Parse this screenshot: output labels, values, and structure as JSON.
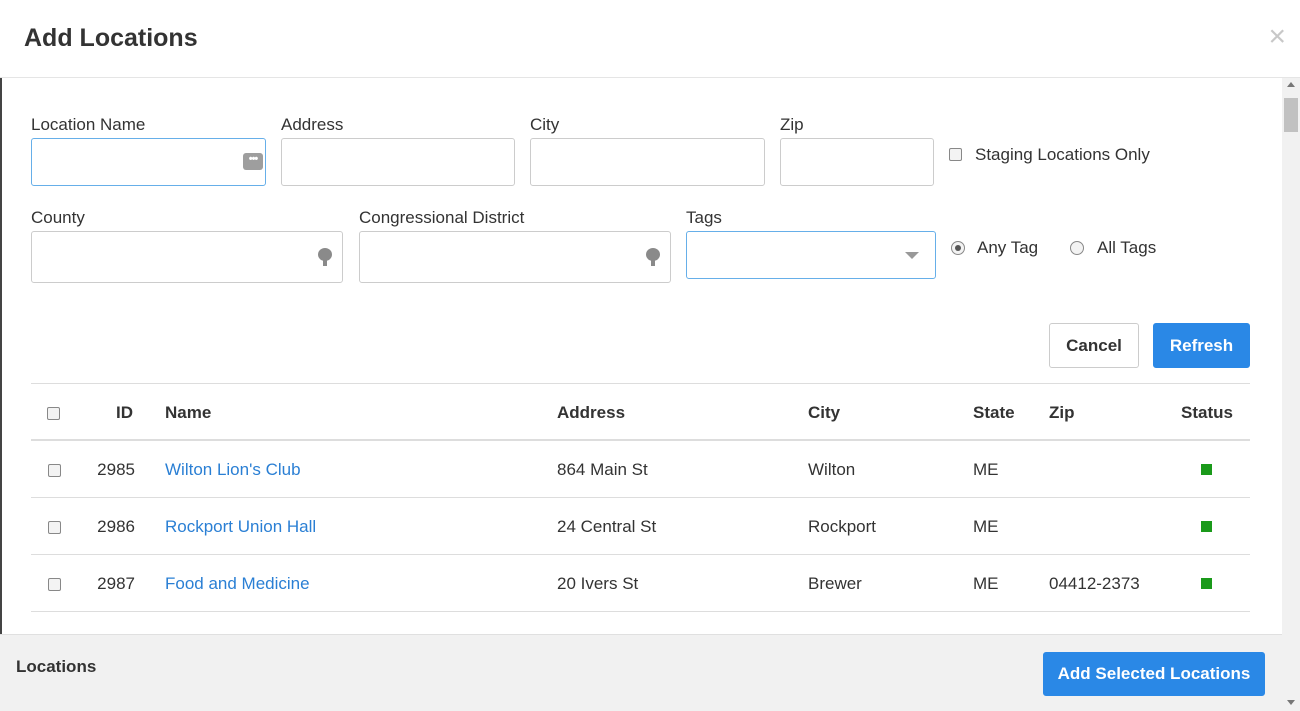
{
  "modal": {
    "title": "Add Locations",
    "close_glyph": "×"
  },
  "filters": {
    "location_name": {
      "label": "Location Name",
      "value": ""
    },
    "address": {
      "label": "Address",
      "value": ""
    },
    "city": {
      "label": "City",
      "value": ""
    },
    "zip": {
      "label": "Zip",
      "value": ""
    },
    "staging_only": {
      "label": "Staging Locations Only",
      "checked": false
    },
    "county": {
      "label": "County",
      "value": ""
    },
    "congressional_district": {
      "label": "Congressional District",
      "value": ""
    },
    "tags": {
      "label": "Tags",
      "value": ""
    },
    "tag_mode": {
      "any_label": "Any Tag",
      "all_label": "All Tags",
      "selected": "any"
    }
  },
  "buttons": {
    "cancel": "Cancel",
    "refresh": "Refresh",
    "add_selected": "Add Selected Locations"
  },
  "table": {
    "columns": {
      "id": "ID",
      "name": "Name",
      "address": "Address",
      "city": "City",
      "state": "State",
      "zip": "Zip",
      "status": "Status"
    },
    "rows": [
      {
        "id": "2985",
        "name": "Wilton Lion's Club",
        "address": "864 Main St",
        "city": "Wilton",
        "state": "ME",
        "zip": "",
        "status": "active"
      },
      {
        "id": "2986",
        "name": "Rockport Union Hall",
        "address": "24 Central St",
        "city": "Rockport",
        "state": "ME",
        "zip": "",
        "status": "active"
      },
      {
        "id": "2987",
        "name": "Food and Medicine",
        "address": "20 Ivers St",
        "city": "Brewer",
        "state": "ME",
        "zip": "04412-2373",
        "status": "active"
      }
    ]
  },
  "footer": {
    "label": "Locations"
  },
  "colors": {
    "primary": "#2a88e6",
    "link": "#2a7fd4",
    "status_active": "#1a9a1a"
  }
}
